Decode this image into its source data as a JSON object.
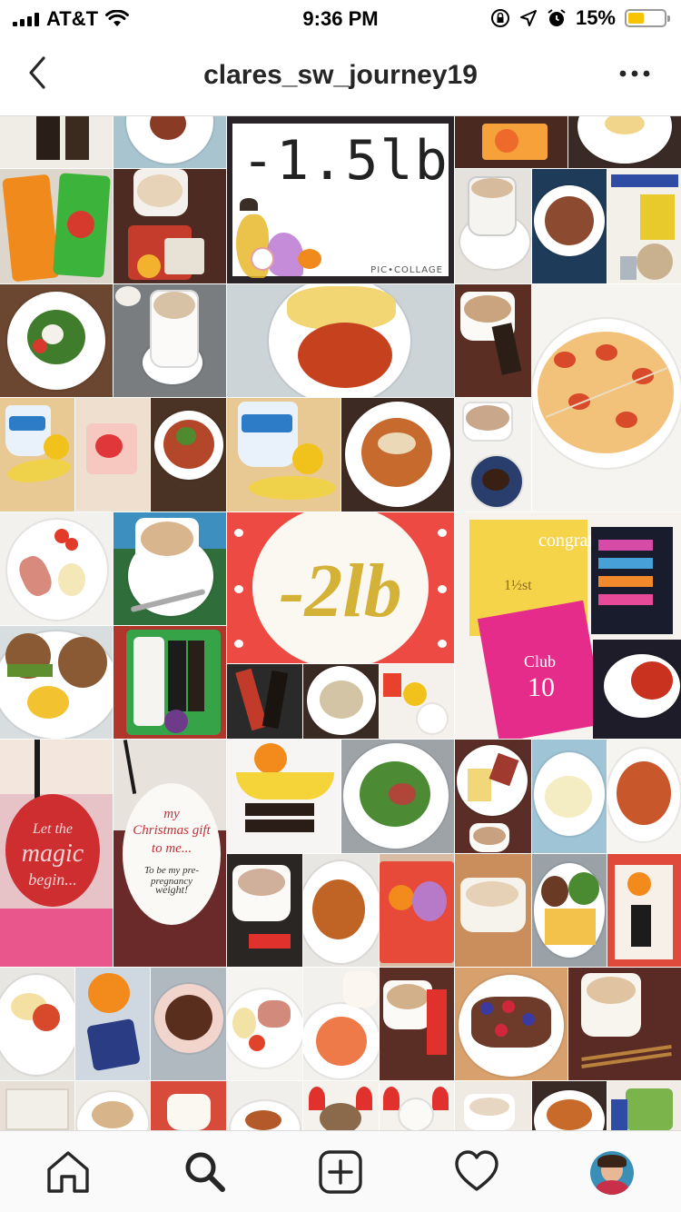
{
  "status_bar": {
    "carrier": "AT&T",
    "time": "9:36 PM",
    "battery_percent": "15%",
    "battery_level": 0.15,
    "icons": [
      "signal-icon",
      "wifi-icon",
      "rotation-lock-icon",
      "location-icon",
      "alarm-icon",
      "battery-icon"
    ]
  },
  "header": {
    "title": "clares_sw_journey19",
    "back_icon": "chevron-left-icon",
    "more_icon": "more-horizontal-icon"
  },
  "grid": {
    "tile_1_5lb": {
      "text": "-1.5lb",
      "brand": "PIC•COLLAGE"
    },
    "tile_2lb": {
      "text": "-2lb"
    },
    "tile_club10": {
      "club": "Club",
      "num": "10",
      "fraction": "1½st",
      "word": "congrat"
    },
    "tile_tag1": {
      "line1": "Let the",
      "line2": "magic",
      "line3": "begin..."
    },
    "tile_tag2": {
      "line1": "my",
      "line2": "Christmas gift",
      "line3": "to me...",
      "line4": "To be my pre-pregnancy",
      "line5": "weight!"
    }
  },
  "colors": {
    "accent_red": "#e8453c",
    "gold": "#d4b238",
    "pink": "#e52c8a",
    "text": "#262626"
  },
  "tab_bar": {
    "items": [
      "home-icon",
      "search-icon",
      "new-post-icon",
      "activity-heart-icon",
      "profile-avatar"
    ],
    "selected": "search-icon"
  }
}
